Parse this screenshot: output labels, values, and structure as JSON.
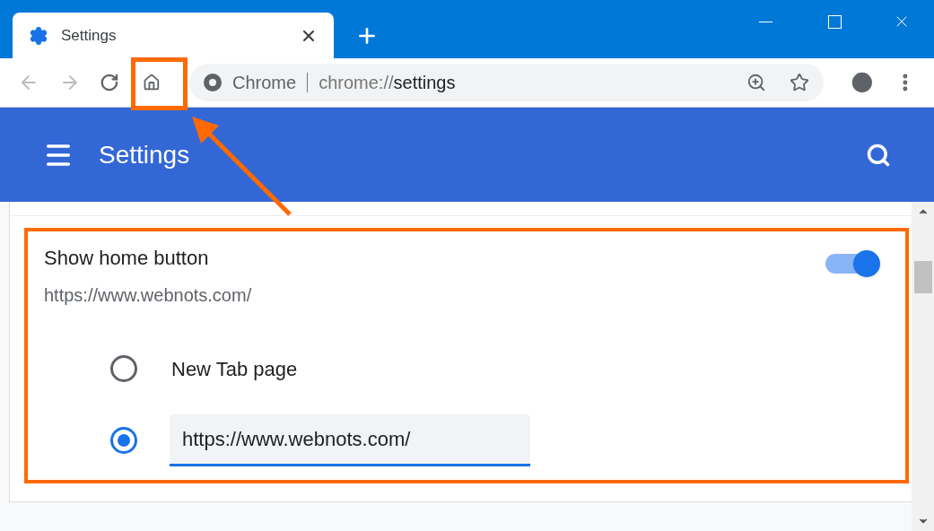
{
  "tab": {
    "title": "Settings"
  },
  "omnibox": {
    "site_label": "Chrome",
    "url_scheme": "chrome://",
    "url_path": "settings"
  },
  "header": {
    "title": "Settings"
  },
  "home_button_setting": {
    "title": "Show home button",
    "subtitle": "https://www.webnots.com/",
    "on": true,
    "options": [
      {
        "kind": "label",
        "label": "New Tab page",
        "selected": false
      },
      {
        "kind": "field",
        "value": "https://www.webnots.com/",
        "selected": true
      }
    ]
  }
}
